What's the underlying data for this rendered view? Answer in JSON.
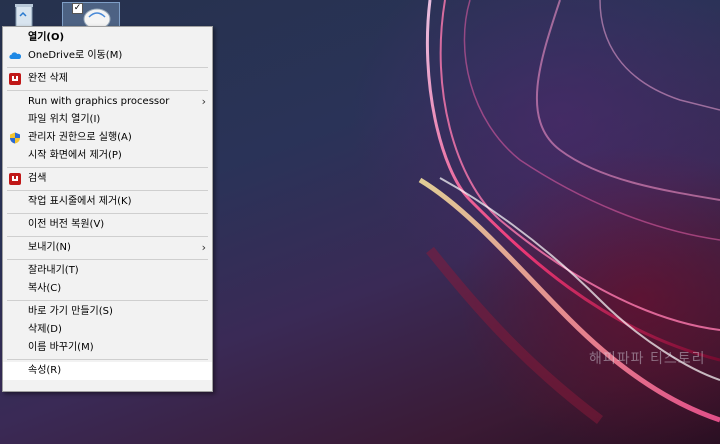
{
  "desktop": {
    "watermark": "해피파파 티스토리"
  },
  "menu": {
    "items": [
      {
        "label": "열기(O)",
        "bold": true
      },
      {
        "label": "OneDrive로 이동(M)",
        "icon": "onedrive-cloud-icon"
      },
      {
        "label": "완전 삭제",
        "icon": "mcafee-shield-icon"
      },
      {
        "label": "Run with graphics processor",
        "submenu": true
      },
      {
        "label": "파일 위치 열기(I)"
      },
      {
        "label": "관리자 권한으로 실행(A)",
        "icon": "uac-shield-icon"
      },
      {
        "label": "시작 화면에서 제거(P)"
      },
      {
        "label": "검색",
        "icon": "mcafee-shield-icon"
      },
      {
        "label": "작업 표시줄에서 제거(K)"
      },
      {
        "label": "이전 버전 복원(V)"
      },
      {
        "label": "보내기(N)",
        "submenu": true
      },
      {
        "label": "잘라내기(T)"
      },
      {
        "label": "복사(C)"
      },
      {
        "label": "바로 가기 만들기(S)"
      },
      {
        "label": "삭제(D)"
      },
      {
        "label": "이름 바꾸기(M)"
      },
      {
        "label": "속성(R)",
        "hover": true
      }
    ],
    "submenu_arrow": "›"
  },
  "colors": {
    "menu_bg": "#f2f2f2",
    "menu_border": "#a0a0a0",
    "hover_bg": "#ffffff",
    "mcafee_red": "#c01818",
    "onedrive_blue": "#1e88e5"
  }
}
